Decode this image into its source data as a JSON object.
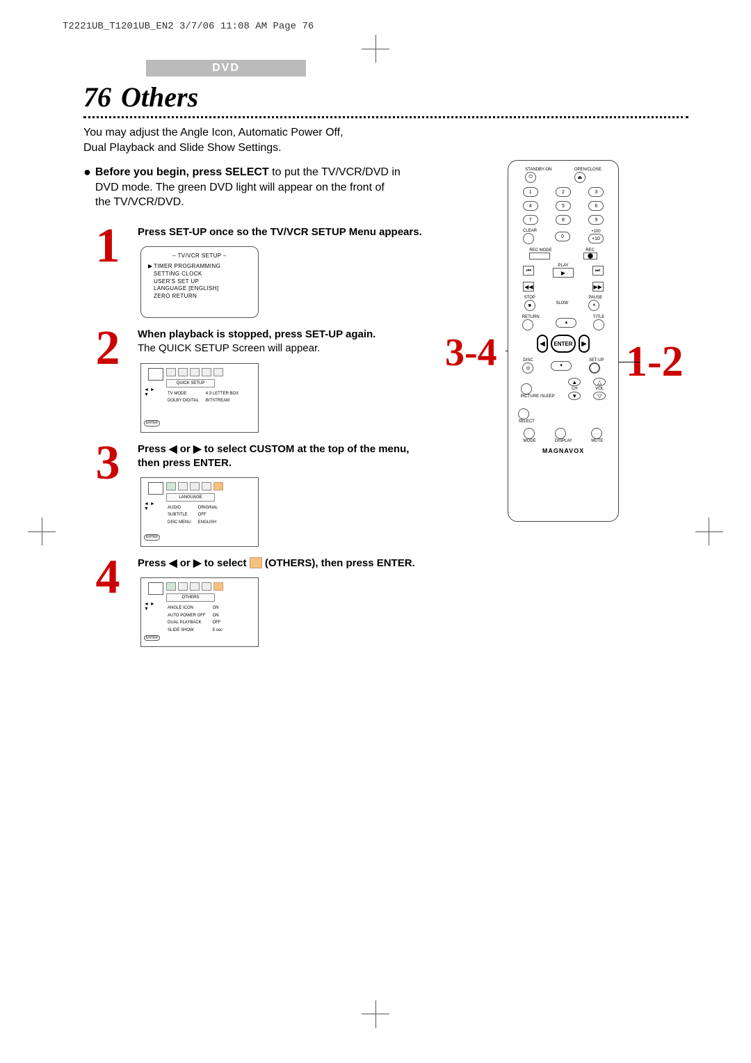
{
  "header_line": "T2221UB_T1201UB_EN2  3/7/06  11:08 AM  Page 76",
  "section_tag": "DVD",
  "page_number": "76",
  "page_title": "Others",
  "intro_line1": "You may adjust the Angle Icon, Automatic Power Off,",
  "intro_line2": "Dual Playback and Slide Show Settings.",
  "bullet_strong": "Before you begin, press SELECT",
  "bullet_rest": " to put the TV/VCR/DVD in DVD mode.  The green DVD light will appear on the front of the TV/VCR/DVD.",
  "steps": {
    "s1": {
      "num": "1",
      "bold": "Press SET-UP once so the TV/VCR SETUP Menu appears.",
      "rest": ""
    },
    "s2": {
      "num": "2",
      "bold": "When playback is stopped, press SET-UP again.",
      "rest": "The QUICK SETUP Screen will appear."
    },
    "s3": {
      "num": "3",
      "bold_a": "Press ",
      "bold_b": " or ",
      "bold_c": " to select CUSTOM at the top of the menu, then press ENTER.",
      "arrow_l": "◀",
      "arrow_r": "▶"
    },
    "s4": {
      "num": "4",
      "bold_a": "Press ",
      "bold_b": " or ",
      "bold_c": " to select ",
      "bold_d": " (OTHERS), then press ENTER.",
      "arrow_l": "◀",
      "arrow_r": "▶"
    }
  },
  "osd1": {
    "title": "– TV/VCR SETUP –",
    "items": [
      "TIMER PROGRAMMING",
      "SETTING CLOCK",
      "USER'S SET UP",
      "LANGUAGE  [ENGLISH]",
      "ZERO RETURN"
    ]
  },
  "osd2": {
    "tab": "QUICK SETUP",
    "rows": [
      [
        "TV MODE",
        "4:3 LETTER BOX"
      ],
      [
        "DOLBY DIGITAL",
        "BITSTREAM"
      ]
    ]
  },
  "osd3": {
    "tab": "LANGUAGE",
    "rows": [
      [
        "AUDIO",
        "ORIGINAL"
      ],
      [
        "SUBTITLE",
        "OFF"
      ],
      [
        "DISC MENU",
        "ENGLISH"
      ]
    ]
  },
  "osd4": {
    "tab": "OTHERS",
    "rows": [
      [
        "ANGLE ICON",
        "ON"
      ],
      [
        "AUTO POWER OFF",
        "ON"
      ],
      [
        "DUAL PLAYBACK",
        "OFF"
      ],
      [
        "SLIDE SHOW",
        "5 sec"
      ]
    ]
  },
  "remote": {
    "standby": "STANDBY-ON",
    "openclose": "OPEN/CLOSE",
    "clear": "CLEAR",
    "plus100": "+100",
    "plus10": "+10",
    "recmode": "REC MODE",
    "rec": "REC",
    "play": "PLAY",
    "stop": "STOP",
    "slow": "SLOW",
    "pause": "PAUSE",
    "return": "RETURN",
    "title": "TITLE",
    "enter": "ENTER",
    "disc": "DISC",
    "setup": "SET-UP",
    "picture_sleep": "PICTURE /SLEEP",
    "ch": "CH",
    "vol": "VOL",
    "select": "SELECT",
    "mode": "MODE",
    "display": "DISPLAY",
    "mute": "MUTE",
    "brand": "MAGNAVOX"
  },
  "callouts": {
    "c34": "3-4",
    "c12": "1-2"
  }
}
